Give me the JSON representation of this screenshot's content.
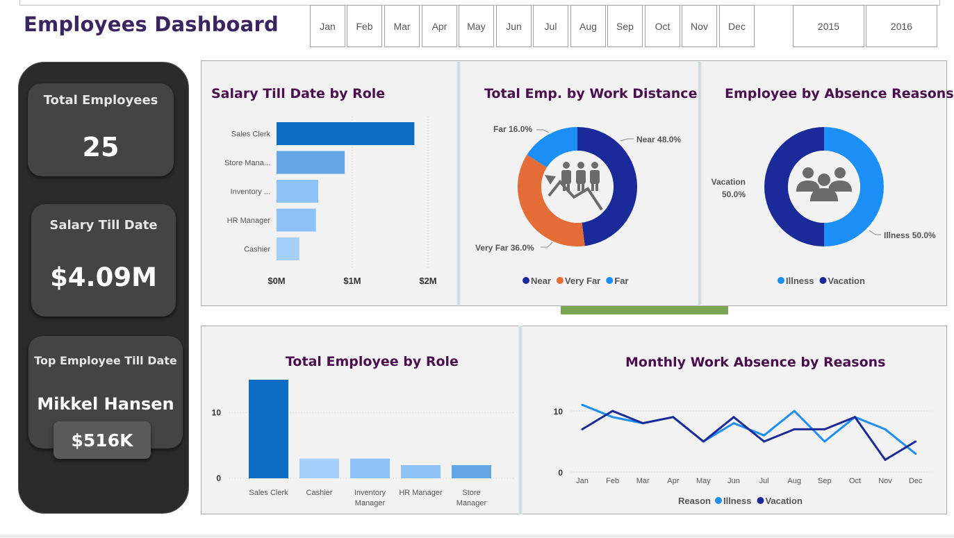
{
  "header": {
    "title": "Employees Dashboard"
  },
  "slicers": {
    "months": [
      "Jan",
      "Feb",
      "Mar",
      "Apr",
      "May",
      "Jun",
      "Jul",
      "Aug",
      "Sep",
      "Oct",
      "Nov",
      "Dec"
    ],
    "years": [
      "2015",
      "2016"
    ]
  },
  "kpis": {
    "total_employees": {
      "label": "Total Employees",
      "value": "25"
    },
    "salary_till_date": {
      "label": "Salary Till Date",
      "value": "$4.09M"
    },
    "top_employee": {
      "label": "Top Employee Till Date",
      "name": "Mikkel Hansen",
      "value": "$516K"
    }
  },
  "colors": {
    "dark_blue": "#1b2a99",
    "blue": "#0f6cc5",
    "light_blue": "#1b8ff5",
    "orange": "#e46c36",
    "title_purple": "#4a0e4e"
  },
  "chart_data": [
    {
      "id": "salary_by_role",
      "type": "bar",
      "orientation": "horizontal",
      "title": "Salary Till Date by Role",
      "categories": [
        "Sales Clerk",
        "Store Mana...",
        "Inventory ...",
        "HR Manager",
        "Cashier"
      ],
      "values": [
        1.82,
        0.9,
        0.55,
        0.52,
        0.3
      ],
      "bar_colors": [
        "#0f6cc5",
        "#64a5e4",
        "#8cc2f5",
        "#8cc2f5",
        "#a4d0fa"
      ],
      "xlim": [
        0,
        2
      ],
      "xticks": [
        "$0M",
        "$1M",
        "$2M"
      ],
      "xlabel": "",
      "ylabel": ""
    },
    {
      "id": "emp_by_distance",
      "type": "pie",
      "donut": true,
      "title": "Total Emp. by Work Distance",
      "slices": [
        {
          "label": "Near",
          "percent": 48.0,
          "display": "Near 48.0%",
          "color": "#1b2a99"
        },
        {
          "label": "Very Far",
          "percent": 36.0,
          "display": "Very Far 36.0%",
          "color": "#e46c36"
        },
        {
          "label": "Far",
          "percent": 16.0,
          "display": "Far 16.0%",
          "color": "#1b8ff5"
        }
      ],
      "legend": [
        "Near",
        "Very Far",
        "Far"
      ],
      "legend_position": "bottom"
    },
    {
      "id": "emp_by_absence",
      "type": "pie",
      "donut": true,
      "title": "Employee by Absence Reasons",
      "slices": [
        {
          "label": "Illness",
          "percent": 50.0,
          "display": "Illness 50.0%",
          "color": "#1b8ff5"
        },
        {
          "label": "Vacation",
          "percent": 50.0,
          "display_line1": "Vacation",
          "display_line2": "50.0%",
          "color": "#1b2a99"
        }
      ],
      "legend": [
        "Illness",
        "Vacation"
      ],
      "legend_position": "bottom"
    },
    {
      "id": "emp_by_role",
      "type": "bar",
      "title": "Total Employee by Role",
      "categories": [
        "Sales Clerk",
        "Cashier",
        "Inventory Manager",
        "HR Manager",
        "Store Manager"
      ],
      "category_lines": [
        [
          "Sales Clerk"
        ],
        [
          "Cashier"
        ],
        [
          "Inventory",
          "Manager"
        ],
        [
          "HR Manager"
        ],
        [
          "Store",
          "Manager"
        ]
      ],
      "values": [
        15,
        3,
        3,
        2,
        2
      ],
      "bar_colors": [
        "#0f6cc5",
        "#a4d0fa",
        "#8cc2f5",
        "#8cc2f5",
        "#64a5e4"
      ],
      "ylim": [
        0,
        15
      ],
      "yticks": [
        "0",
        "10"
      ],
      "xlabel": "",
      "ylabel": ""
    },
    {
      "id": "monthly_absence",
      "type": "line",
      "title": "Monthly Work Absence by Reasons",
      "x": [
        "Jan",
        "Feb",
        "Mar",
        "Apr",
        "May",
        "Jun",
        "Jul",
        "Aug",
        "Sep",
        "Oct",
        "Nov",
        "Dec"
      ],
      "series": [
        {
          "name": "Illness",
          "values": [
            11,
            9,
            8,
            9,
            5,
            8,
            6,
            10,
            5,
            9,
            7,
            3
          ],
          "color": "#1b8ff5"
        },
        {
          "name": "Vacation",
          "values": [
            7,
            10,
            8,
            9,
            5,
            9,
            5,
            7,
            7,
            9,
            2,
            5
          ],
          "color": "#1b2a99"
        }
      ],
      "legend_title": "Reason",
      "legend": [
        "Illness",
        "Vacation"
      ],
      "legend_position": "bottom",
      "ylim": [
        0,
        12
      ],
      "yticks": [
        "0",
        "10"
      ]
    }
  ]
}
